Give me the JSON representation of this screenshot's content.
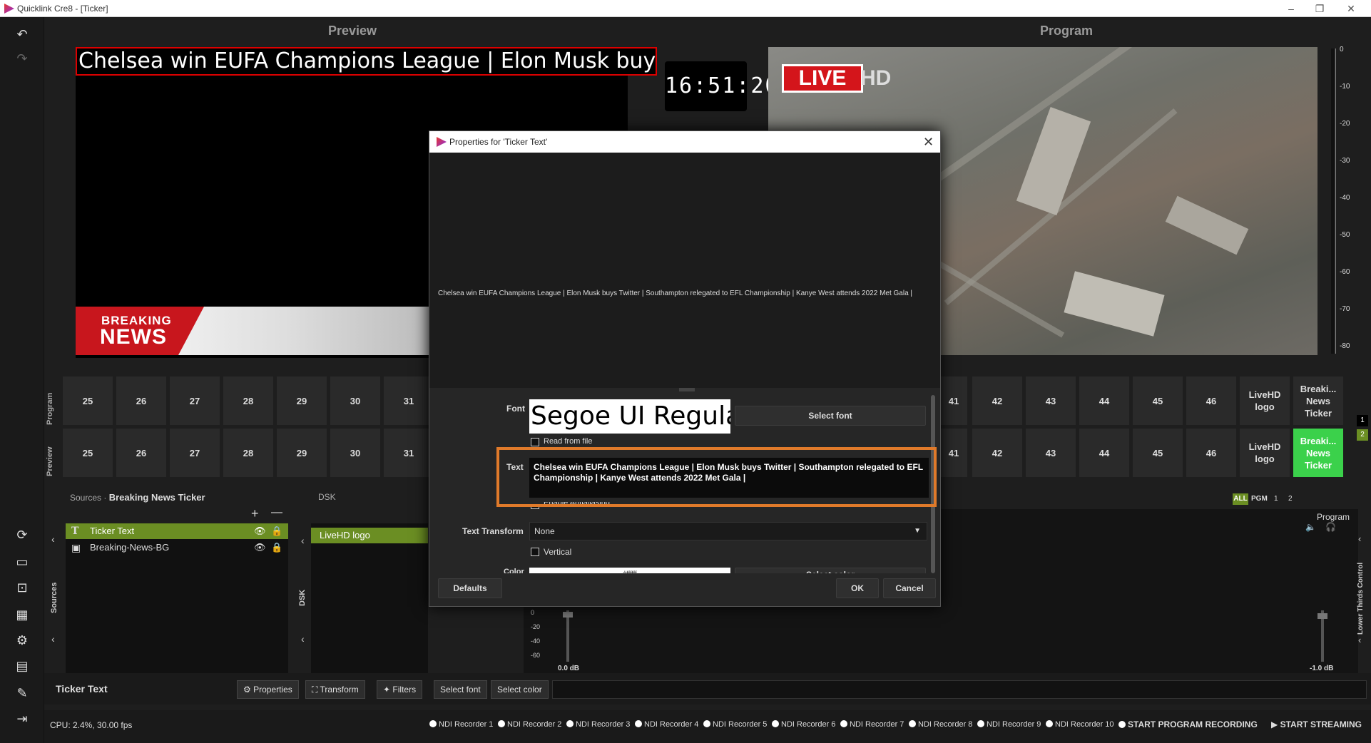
{
  "window": {
    "title": "Quicklink Cre8 - [Ticker]",
    "minimize": "–",
    "maximize": "❐",
    "close": "✕"
  },
  "sidebar": {
    "icons": [
      "undo-icon",
      "redo-icon",
      "refresh-icon",
      "monitor-icon",
      "screen-icon",
      "grid-icon",
      "gear-icon",
      "folder-icon",
      "tools-icon",
      "exit-icon"
    ]
  },
  "preview": {
    "title": "Preview",
    "ticker_text": "Chelsea win EUFA Champions League   |   Elon Musk buys T",
    "clock": "16:51:20",
    "breaking_line1": "BREAKING",
    "breaking_line2": "NEWS"
  },
  "program": {
    "title": "Program",
    "live_label": "LIVE",
    "hd_label": "HD",
    "meter_ticks": [
      "0",
      "-10",
      "-20",
      "-30",
      "-40",
      "-50",
      "-60",
      "-70",
      "-80"
    ]
  },
  "grid": {
    "program_label": "Program",
    "preview_label": "Preview",
    "left_cells": [
      "25",
      "26",
      "27",
      "28",
      "29",
      "30",
      "31"
    ],
    "right_cells": [
      "41",
      "42",
      "43",
      "44",
      "45",
      "46"
    ],
    "logo_cell": "LiveHD logo",
    "ticker_cell": "Breaki... News Ticker",
    "page_numbers": [
      "1",
      "2"
    ],
    "filters": [
      "ALL",
      "PGM",
      "1",
      "2"
    ]
  },
  "sources": {
    "header_label": "Sources",
    "header_scene": "Breaking News Ticker",
    "side_label": "Sources",
    "add": "+",
    "remove": "—",
    "items": [
      {
        "name": "Ticker Text",
        "icon": "text-icon"
      },
      {
        "name": "Breaking-News-BG",
        "icon": "image-icon"
      }
    ]
  },
  "dsk": {
    "header_label": "DSK",
    "side_label": "DSK",
    "items": [
      "LiveHD logo"
    ]
  },
  "audio": {
    "program_label": "Program",
    "lower_thirds": "Lower Thirds Control",
    "ticks": [
      "0",
      "-20",
      "-40",
      "-60"
    ],
    "left_db": "0.0 dB",
    "right_db": "-1.0 dB"
  },
  "toolbar": {
    "selected": "Ticker Text",
    "buttons": [
      "Properties",
      "Transform",
      "Filters",
      "Select font",
      "Select color"
    ]
  },
  "status": {
    "cpu": "CPU: 2.4%, 30.00 fps",
    "recorders": [
      "NDI Recorder 1",
      "NDI Recorder 2",
      "NDI Recorder 3",
      "NDI Recorder 4",
      "NDI Recorder 5",
      "NDI Recorder 6",
      "NDI Recorder 7",
      "NDI Recorder 8",
      "NDI Recorder 9",
      "NDI Recorder 10"
    ],
    "start_recording": "START PROGRAM RECORDING",
    "start_streaming": "START STREAMING"
  },
  "dialog": {
    "title": "Properties for 'Ticker Text'",
    "preview_text": "Chelsea win EUFA Champions League   |   Elon Musk buys Twitter   |   Southampton relegated to EFL Championship   |   Kanye West attends 2022 Met Gala   |",
    "font_label": "Font",
    "font_value": "Segoe UI Regular",
    "select_font": "Select font",
    "read_from_file": "Read from file",
    "text_label": "Text",
    "text_value": "Chelsea win EUFA Champions League   |   Elon Musk buys Twitter   |   Southampton relegated to EFL Championship   |   Kanye West attends 2022 Met Gala   |",
    "antialias": "Enable Antialiasing",
    "transform_label": "Text Transform",
    "transform_value": "None",
    "vertical": "Vertical",
    "color_label": "Color",
    "color_value": "#ffffff",
    "select_color": "Select color",
    "defaults": "Defaults",
    "ok": "OK",
    "cancel": "Cancel",
    "highlight_color": "#e07a2a"
  }
}
